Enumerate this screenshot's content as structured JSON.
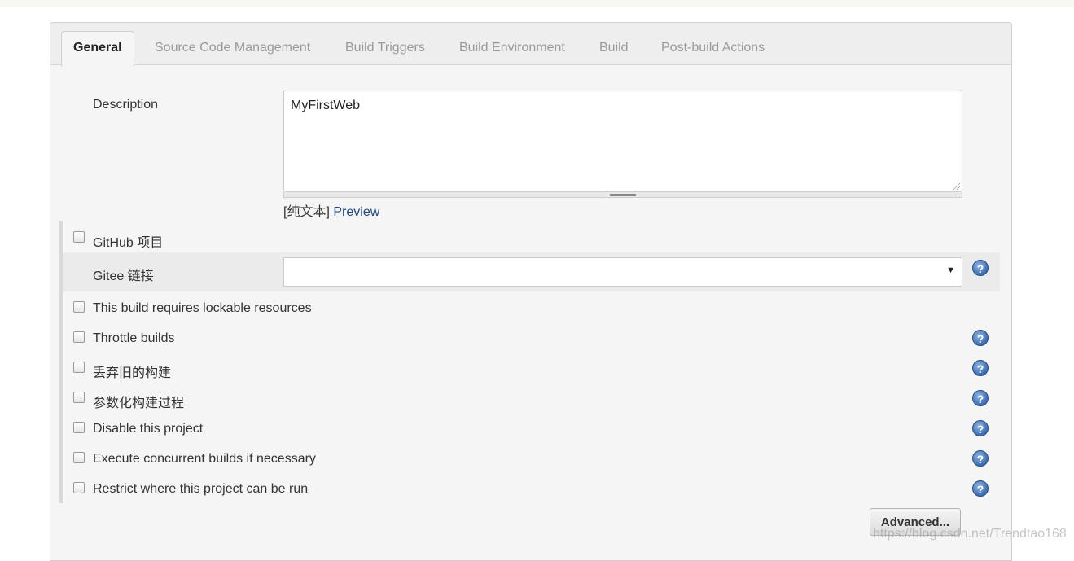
{
  "tabs": [
    {
      "label": "General",
      "active": true
    },
    {
      "label": "Source Code Management",
      "active": false
    },
    {
      "label": "Build Triggers",
      "active": false
    },
    {
      "label": "Build Environment",
      "active": false
    },
    {
      "label": "Build",
      "active": false
    },
    {
      "label": "Post-build Actions",
      "active": false
    }
  ],
  "description": {
    "label": "Description",
    "value": "MyFirstWeb",
    "format_note": "[纯文本]",
    "preview_link": "Preview"
  },
  "github": {
    "label": "GitHub 项目",
    "checked": false
  },
  "gitee": {
    "label": "Gitee 链接",
    "selected": "",
    "arrow": "▼",
    "help": "?"
  },
  "options": [
    {
      "label": "This build requires lockable resources",
      "checked": false,
      "help": ""
    },
    {
      "label": "Throttle builds",
      "checked": false,
      "help": "?"
    },
    {
      "label": "丢弃旧的构建",
      "checked": false,
      "help": "?"
    },
    {
      "label": "参数化构建过程",
      "checked": false,
      "help": "?"
    },
    {
      "label": "Disable this project",
      "checked": false,
      "help": "?"
    },
    {
      "label": "Execute concurrent builds if necessary",
      "checked": false,
      "help": "?"
    },
    {
      "label": "Restrict where this project can be run",
      "checked": false,
      "help": "?"
    }
  ],
  "advanced_button": "Advanced...",
  "watermark": "https://blog.csdn.net/Trendtao168",
  "colors": {
    "link": "#204a87",
    "help_icon": "#3a6db5",
    "panel_bg": "#f5f5f5"
  }
}
